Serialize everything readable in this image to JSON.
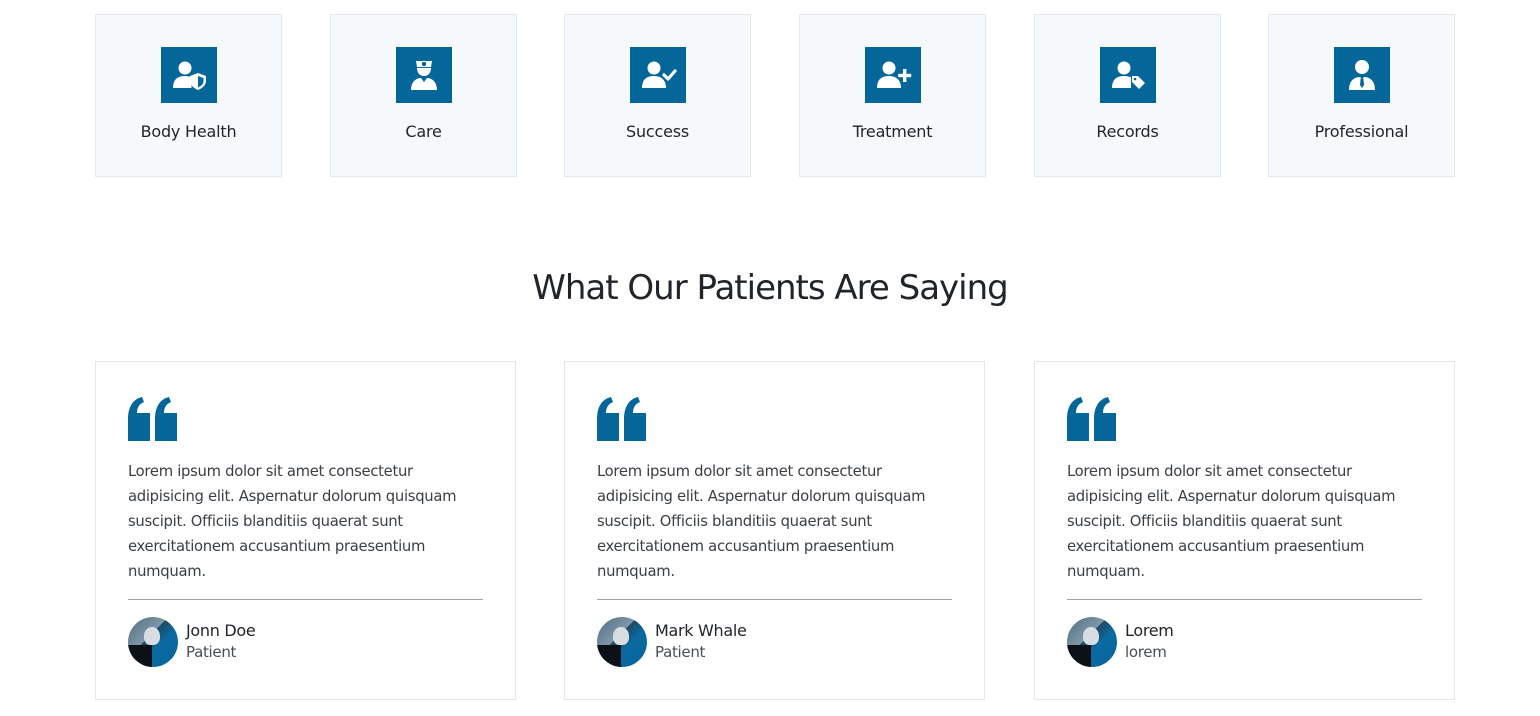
{
  "brand": {
    "accent": "#05669a",
    "feature_bg": "#f5f9fc"
  },
  "features": [
    {
      "label": "Body Health",
      "icon": "user-shield-icon"
    },
    {
      "label": "Care",
      "icon": "user-nurse-icon"
    },
    {
      "label": "Success",
      "icon": "user-check-icon"
    },
    {
      "label": "Treatment",
      "icon": "user-plus-icon"
    },
    {
      "label": "Records",
      "icon": "user-tag-icon"
    },
    {
      "label": "Professional",
      "icon": "user-tie-icon"
    }
  ],
  "testimonials_section": {
    "title": "What Our Patients Are Saying",
    "items": [
      {
        "quote": "Lorem ipsum dolor sit amet consectetur adipisicing elit. Aspernatur dolorum quisquam suscipit. Officiis blanditiis quaerat sunt exercitationem accusantium praesentium numquam.",
        "name": "Jonn Doe",
        "role": "Patient"
      },
      {
        "quote": "Lorem ipsum dolor sit amet consectetur adipisicing elit. Aspernatur dolorum quisquam suscipit. Officiis blanditiis quaerat sunt exercitationem accusantium praesentium numquam.",
        "name": "Mark Whale",
        "role": "Patient"
      },
      {
        "quote": "Lorem ipsum dolor sit amet consectetur adipisicing elit. Aspernatur dolorum quisquam suscipit. Officiis blanditiis quaerat sunt exercitationem accusantium praesentium numquam.",
        "name": "Lorem",
        "role": "lorem"
      }
    ]
  }
}
